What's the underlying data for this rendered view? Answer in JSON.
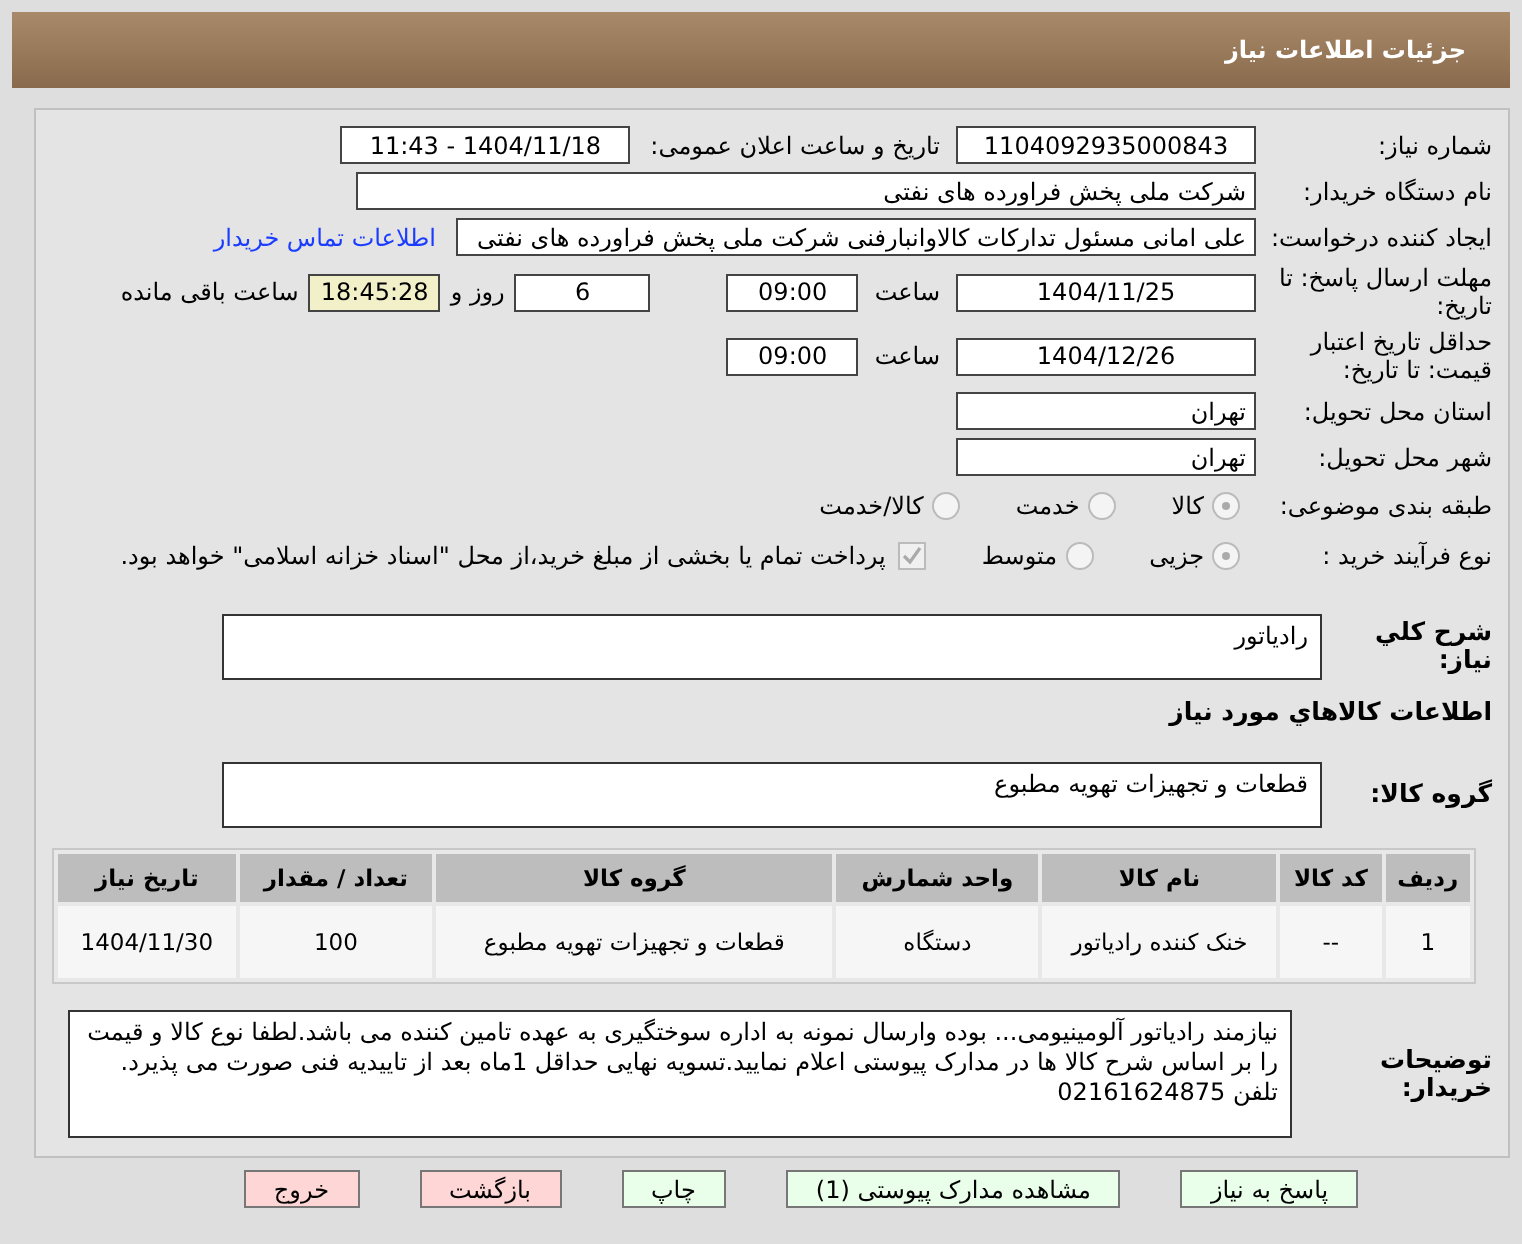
{
  "page_title": "جزئیات اطلاعات نیاز",
  "need_number": {
    "label": "شماره نیاز:",
    "value": "1104092935000843"
  },
  "announce": {
    "label": "تاریخ و ساعت اعلان عمومی:",
    "value": "1404/11/18 - 11:43"
  },
  "buyer": {
    "label": "نام دستگاه خریدار:",
    "value": "شرکت ملی پخش فراورده های نفتی"
  },
  "creator": {
    "label": "ایجاد کننده درخواست:",
    "value": "علی امانی مسئول تدارکات کالاوانبارفنی شرکت ملی پخش فراورده های نفتی",
    "link": "اطلاعات تماس خریدار"
  },
  "deadline": {
    "label": "مهلت ارسال پاسخ: تا تاریخ:",
    "date": "1404/11/25",
    "time_label": "ساعت",
    "time": "09:00",
    "days": "6",
    "days_label": "روز و",
    "remaining": "18:45:28",
    "remaining_label": "ساعت باقی مانده"
  },
  "validity": {
    "label": "حداقل تاریخ اعتبار قیمت: تا تاریخ:",
    "date": "1404/12/26",
    "time_label": "ساعت",
    "time": "09:00"
  },
  "province": {
    "label": "استان محل تحویل:",
    "value": "تهران"
  },
  "city": {
    "label": "شهر محل تحویل:",
    "value": "تهران"
  },
  "category": {
    "label": "طبقه بندی موضوعی:",
    "options": [
      {
        "label": "کالا",
        "selected": true
      },
      {
        "label": "خدمت",
        "selected": false
      },
      {
        "label": "کالا/خدمت",
        "selected": false
      }
    ]
  },
  "process": {
    "label": "نوع فرآیند خرید :",
    "options": [
      {
        "label": "جزیی",
        "selected": true
      },
      {
        "label": "متوسط",
        "selected": false
      }
    ],
    "payment": {
      "checked": true,
      "text": "پرداخت تمام یا بخشی از مبلغ خرید،از محل \"اسناد خزانه اسلامی\" خواهد بود."
    }
  },
  "summary": {
    "label": "شرح کلي نياز:",
    "value": "رادیاتور"
  },
  "goods_heading": "اطلاعات كالاهاي مورد نياز",
  "goods_group": {
    "label": "گروه کالا:",
    "value": "قطعات و تجهیزات تهویه مطبوع"
  },
  "table": {
    "columns": [
      "ردیف",
      "کد کالا",
      "نام کالا",
      "واحد شمارش",
      "گروه کالا",
      "تعداد / مقدار",
      "تاریخ نیاز"
    ],
    "rows": [
      [
        "1",
        "--",
        "خنک کننده رادیاتور",
        "دستگاه",
        "قطعات و تجهیزات تهویه مطبوع",
        "100",
        "1404/11/30"
      ]
    ]
  },
  "notes": {
    "label": "توضیحات خریدار:",
    "value": "نیازمند رادیاتور آلومینیومی... بوده وارسال نمونه به اداره سوختگیری به عهده تامین کننده می باشد.لطفا نوع کالا و قیمت را بر اساس شرح کالا ها در مدارک پیوستی اعلام نمایید.تسویه نهایی حداقل 1ماه بعد از تاییدیه فنی صورت می پذیرد. تلفن 02161624875"
  },
  "buttons": [
    {
      "label": "پاسخ به نیاز",
      "kind": "primary"
    },
    {
      "label": "مشاهده مدارک پیوستی (1)",
      "kind": "primary"
    },
    {
      "label": "چاپ",
      "kind": "primary"
    },
    {
      "label": "بازگشت",
      "kind": "danger"
    },
    {
      "label": "خروج",
      "kind": "danger"
    }
  ]
}
